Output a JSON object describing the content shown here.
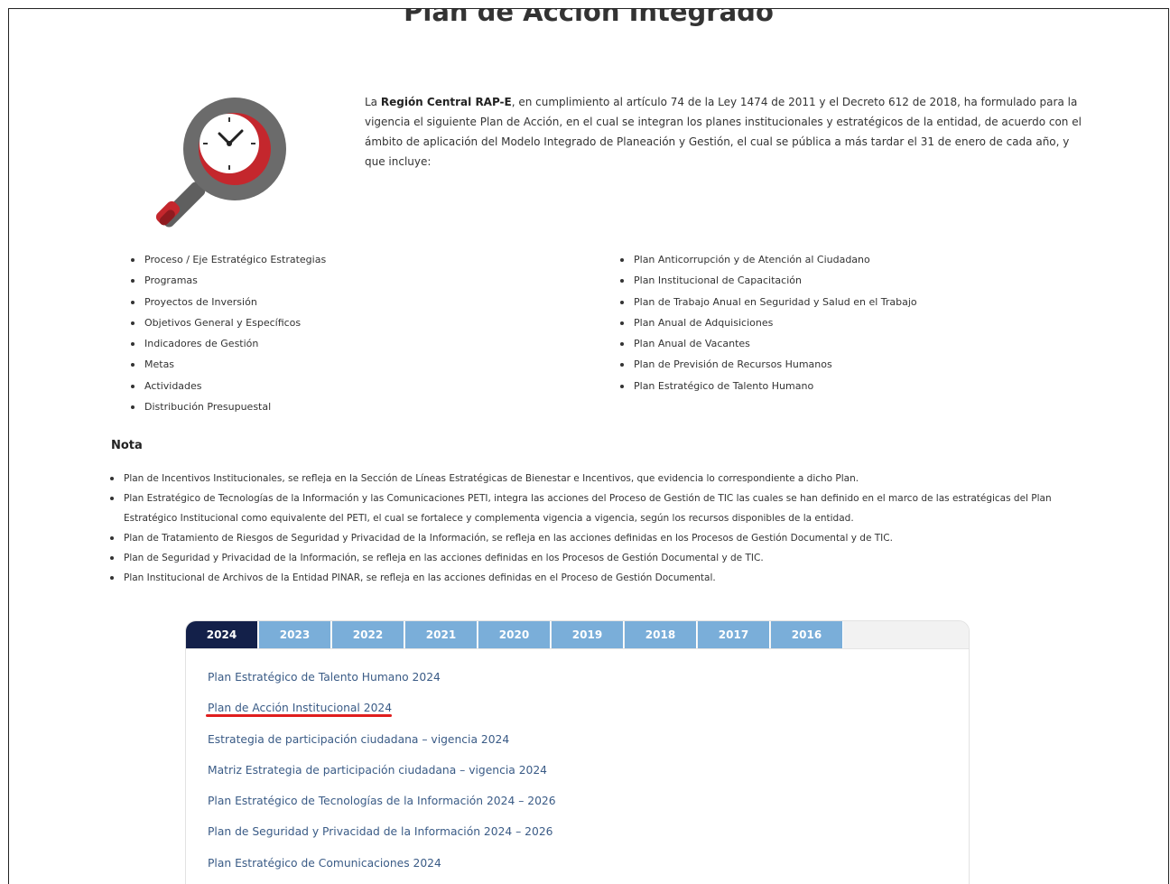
{
  "page": {
    "title": "Plan de Acción Integrado"
  },
  "intro": {
    "before": "La ",
    "org": "Región Central RAP-E",
    "after": ", en cumplimiento al artículo 74 de la Ley 1474 de 2011 y el Decreto 612 de 2018, ha formulado para la vigencia el siguiente Plan de Acción, en el cual se integran los planes institucionales y estratégicos de la entidad, de acuerdo con el ámbito de aplicación del Modelo Integrado de Planeación y Gestión, el cual se pública a más tardar el 31 de enero de cada año, y que incluye:"
  },
  "illustration": {
    "icon": "magnifier-clock-icon",
    "colors": {
      "ring": "#6b6b6b",
      "accent": "#c4272d",
      "face": "#ffffff"
    }
  },
  "list_left": [
    "Proceso / Eje Estratégico Estrategias",
    "Programas",
    "Proyectos de Inversión",
    "Objetivos General y Específicos",
    "Indicadores de Gestión",
    "Metas",
    "Actividades",
    "Distribución Presupuestal"
  ],
  "list_right": [
    "Plan Anticorrupción y de Atención al Ciudadano",
    "Plan Institucional de Capacitación",
    "Plan de Trabajo Anual en Seguridad y Salud en el Trabajo",
    "Plan Anual de Adquisiciones",
    "Plan Anual de Vacantes",
    "Plan de Previsión de Recursos Humanos",
    "Plan Estratégico de Talento Humano"
  ],
  "nota": {
    "title": "Nota",
    "items": [
      "Plan de Incentivos Institucionales, se refleja en la Sección de Líneas Estratégicas de Bienestar e Incentivos, que evidencia lo correspondiente a dicho Plan.",
      "Plan Estratégico de Tecnologías de la Información y las Comunicaciones  PETI, integra las acciones del Proceso de Gestión de TIC las cuales se han definido en el marco de las estratégicas del Plan Estratégico Institucional como equivalente del PETI, el cual se fortalece y complementa vigencia a vigencia, según los recursos disponibles de la entidad.",
      "Plan de Tratamiento de Riesgos de Seguridad y Privacidad de la Información, se refleja en las acciones definidas en los Procesos de Gestión Documental y de TIC.",
      "Plan de Seguridad y Privacidad de la Información, se refleja en las acciones definidas en los Procesos de Gestión Documental y de TIC.",
      "Plan Institucional de Archivos de la Entidad PINAR, se refleja en las acciones definidas en el Proceso de Gestión Documental."
    ]
  },
  "tabs": {
    "active": "2024",
    "items": [
      "2024",
      "2023",
      "2022",
      "2021",
      "2020",
      "2019",
      "2018",
      "2017",
      "2016"
    ],
    "colors": {
      "active": "#132049",
      "inactive": "#7aaed9"
    }
  },
  "documents": [
    "Plan Estratégico de Talento Humano 2024",
    "Plan de Acción Institucional 2024",
    "Estrategia de participación ciudadana – vigencia 2024",
    "Matriz Estrategia de participación ciudadana – vigencia 2024",
    "Plan Estratégico de Tecnologías de la Información 2024 – 2026",
    "Plan de Seguridad y Privacidad de la Información 2024 – 2026",
    "Plan Estratégico de Comunicaciones 2024"
  ],
  "highlight": {
    "color": "#e01e1e",
    "document": "Plan de Acción Institucional 2024"
  }
}
